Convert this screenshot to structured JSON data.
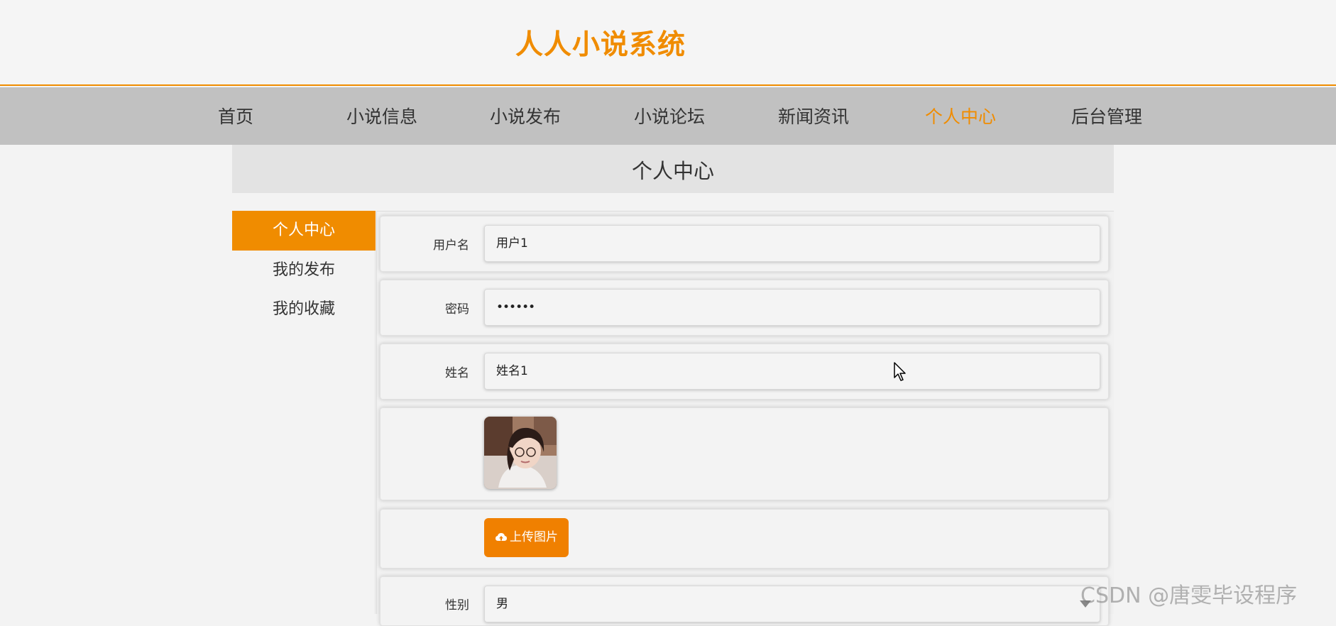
{
  "site": {
    "title": "人人小说系统"
  },
  "nav": {
    "items": [
      {
        "label": "首页"
      },
      {
        "label": "小说信息"
      },
      {
        "label": "小说发布"
      },
      {
        "label": "小说论坛"
      },
      {
        "label": "新闻资讯"
      },
      {
        "label": "个人中心"
      },
      {
        "label": "后台管理"
      }
    ],
    "active_label": "个人中心"
  },
  "page": {
    "title": "个人中心"
  },
  "sidebar": {
    "items": [
      {
        "label": "个人中心"
      },
      {
        "label": "我的发布"
      },
      {
        "label": "我的收藏"
      }
    ],
    "active_label": "个人中心"
  },
  "form": {
    "username": {
      "label": "用户名",
      "value": "用户1"
    },
    "password": {
      "label": "密码",
      "value": "••••••"
    },
    "name": {
      "label": "姓名",
      "value": "姓名1"
    },
    "upload": {
      "label": "上传图片",
      "icon": "cloud-upload-icon"
    },
    "gender": {
      "label": "性别",
      "value": "男"
    }
  },
  "watermark": {
    "text": "CSDN @唐雯毕设程序"
  },
  "colors": {
    "accent": "#f08c00",
    "nav_bg": "#c1c1c1",
    "banner_bg": "#e3e3e3"
  }
}
